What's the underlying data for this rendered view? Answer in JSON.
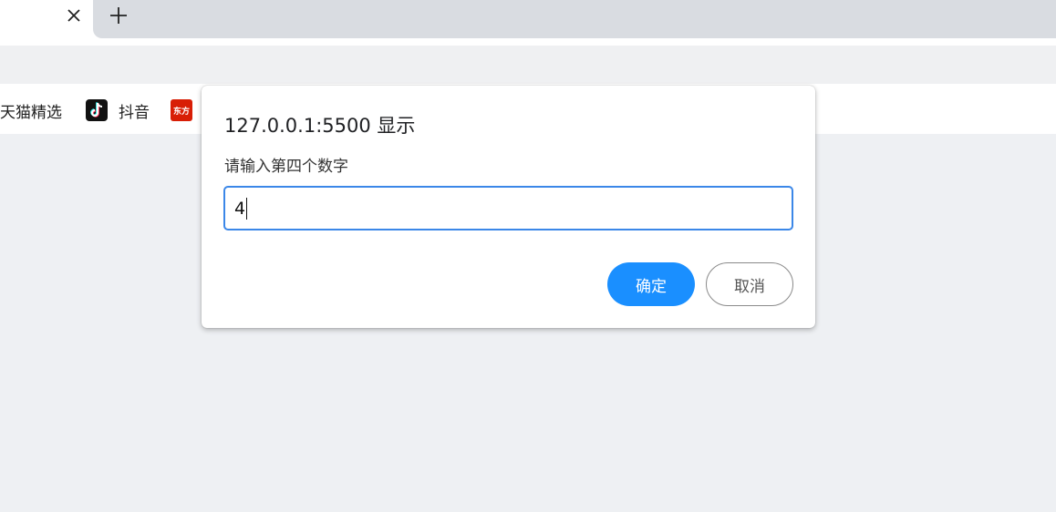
{
  "tabs": {
    "close_glyph": "✕",
    "new_tab_glyph": "+"
  },
  "bookmarks": [
    {
      "label": "天猫精选",
      "icon": "none"
    },
    {
      "label": "抖音",
      "icon": "tiktok-icon"
    },
    {
      "label": "",
      "icon": "dongfang-icon",
      "icon_text": "东方"
    }
  ],
  "dialog": {
    "title": "127.0.0.1:5500 显示",
    "message": "请输入第四个数字",
    "input_value": "4",
    "ok_label": "确定",
    "cancel_label": "取消"
  },
  "colors": {
    "accent": "#1a8fff",
    "input_border": "#3b87e8",
    "tiktok": "#111111",
    "dongfang": "#d81e06"
  }
}
